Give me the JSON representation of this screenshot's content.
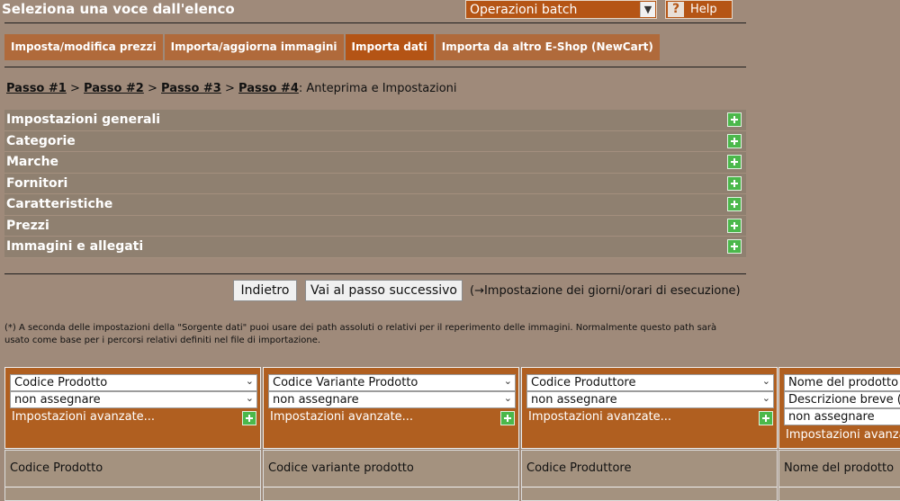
{
  "header": {
    "title": "Seleziona una voce dall'elenco",
    "batch_select": "Operazioni batch",
    "help_label": "Help"
  },
  "tabs": [
    {
      "label": "Imposta/modifica prezzi",
      "active": false
    },
    {
      "label": "Importa/aggiorna immagini",
      "active": false
    },
    {
      "label": "Importa dati",
      "active": true
    },
    {
      "label": "Importa da altro E-Shop (NewCart)",
      "active": false
    }
  ],
  "breadcrumb": {
    "steps": [
      "Passo #1",
      "Passo #2",
      "Passo #3",
      "Passo #4"
    ],
    "separator": ">",
    "current": ": Anteprima e Impostazioni"
  },
  "sections": [
    "Impostazioni generali",
    "Categorie",
    "Marche",
    "Fornitori",
    "Caratteristiche",
    "Prezzi",
    "Immagini e allegati"
  ],
  "buttons": {
    "back": "Indietro",
    "next": "Vai al passo successivo",
    "next_hint": "(→Impostazione dei giorni/orari di esecuzione)"
  },
  "note": "(*) A seconda delle impostazioni della \"Sorgente dati\" puoi usare dei path assoluti o relativi per il reperimento delle immagini. Normalmente questo path sarà usato come base per i percorsi relativi definiti nel file di importazione.",
  "mapping": {
    "advanced_label": "Impostazioni avanzate...",
    "columns": [
      {
        "field": "Codice Prodotto",
        "assign": "non assegnare",
        "source_label": "Codice Prodotto"
      },
      {
        "field": "Codice Variante Prodotto",
        "assign": "non assegnare",
        "source_label": "Codice variante prodotto"
      },
      {
        "field": "Codice Produttore",
        "assign": "non assegnare",
        "source_label": "Codice Produttore"
      },
      {
        "field": "Nome del prodotto (",
        "extra": "Descrizione breve (i",
        "assign": "non assegnare",
        "source_label": "Nome del prodotto"
      }
    ]
  },
  "colors": {
    "background": "#9f8a7a",
    "accent": "#b45415",
    "tab": "#b06a3b",
    "section": "#8f8070",
    "plus": "#4bb84b"
  }
}
